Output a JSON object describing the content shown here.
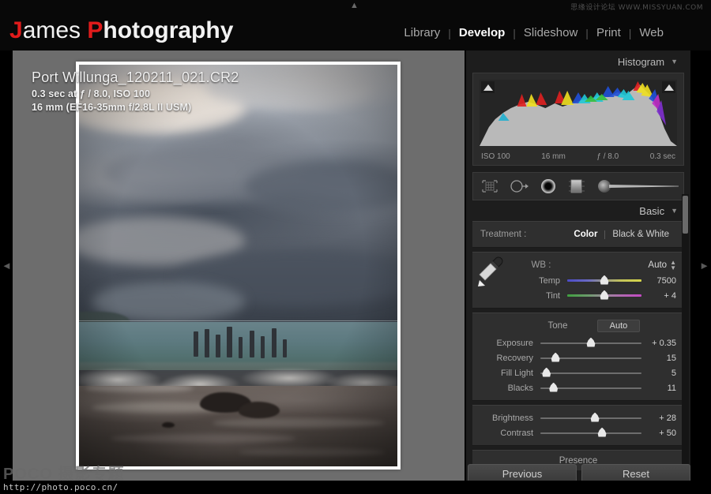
{
  "app": {
    "logo_first": "J",
    "logo_first_rest": "ames ",
    "logo_second": "P",
    "logo_second_rest": "hotography",
    "watermark_top": "思缘设计论坛  WWW.MISSYUAN.COM",
    "watermark_bottom_line1": "POCO 摄影专题",
    "watermark_bottom_line2": "http://photo.poco.cn/"
  },
  "modules": [
    {
      "label": "Library",
      "active": false
    },
    {
      "label": "Develop",
      "active": true
    },
    {
      "label": "Slideshow",
      "active": false
    },
    {
      "label": "Print",
      "active": false
    },
    {
      "label": "Web",
      "active": false
    }
  ],
  "module_separator": "|",
  "image_info": {
    "filename": "Port Willunga_120211_021.CR2",
    "exposure_line": "0.3 sec at ƒ / 8.0, ISO 100",
    "lens_line": "16 mm (EF16-35mm f/2.8L II USM)"
  },
  "histogram": {
    "title": "Histogram",
    "collapse_glyph": "▼",
    "clip_left_glyph": "▲",
    "clip_right_glyph": "▲",
    "meta": {
      "iso": "ISO 100",
      "focal": "16 mm",
      "aperture": "ƒ / 8.0",
      "shutter": "0.3 sec"
    }
  },
  "tools": [
    {
      "name": "crop-overlay-tool"
    },
    {
      "name": "spot-removal-tool"
    },
    {
      "name": "red-eye-correction-tool"
    },
    {
      "name": "graduated-filter-tool"
    },
    {
      "name": "adjustment-brush-tool"
    }
  ],
  "basic": {
    "title": "Basic",
    "collapse_glyph": "▼",
    "treatment": {
      "label": "Treatment :",
      "options": [
        {
          "label": "Color",
          "active": true
        },
        {
          "label": "Black & White",
          "active": false
        }
      ]
    },
    "wb": {
      "label": "WB :",
      "value": "Auto",
      "chevron_up": "▲",
      "chevron_down": "▼",
      "sliders": [
        {
          "name": "Temp",
          "value": "7500",
          "pos": 50,
          "kind": "temp"
        },
        {
          "name": "Tint",
          "value": "+ 4",
          "pos": 50,
          "kind": "tint"
        }
      ]
    },
    "tone": {
      "label": "Tone",
      "auto_label": "Auto",
      "sliders": [
        {
          "name": "Exposure",
          "value": "+ 0.35",
          "pos": 50
        },
        {
          "name": "Recovery",
          "value": "15",
          "pos": 15
        },
        {
          "name": "Fill Light",
          "value": "5",
          "pos": 6
        },
        {
          "name": "Blacks",
          "value": "11",
          "pos": 13
        }
      ]
    },
    "appearance": {
      "sliders": [
        {
          "name": "Brightness",
          "value": "+ 28",
          "pos": 54
        },
        {
          "name": "Contrast",
          "value": "+ 50",
          "pos": 61
        }
      ]
    },
    "presence_label": "Presence"
  },
  "footer_buttons": {
    "previous": "Previous",
    "reset": "Reset"
  },
  "collapse_arrows": {
    "top": "▲",
    "bottom": "▼",
    "left": "◄",
    "right": "►"
  }
}
